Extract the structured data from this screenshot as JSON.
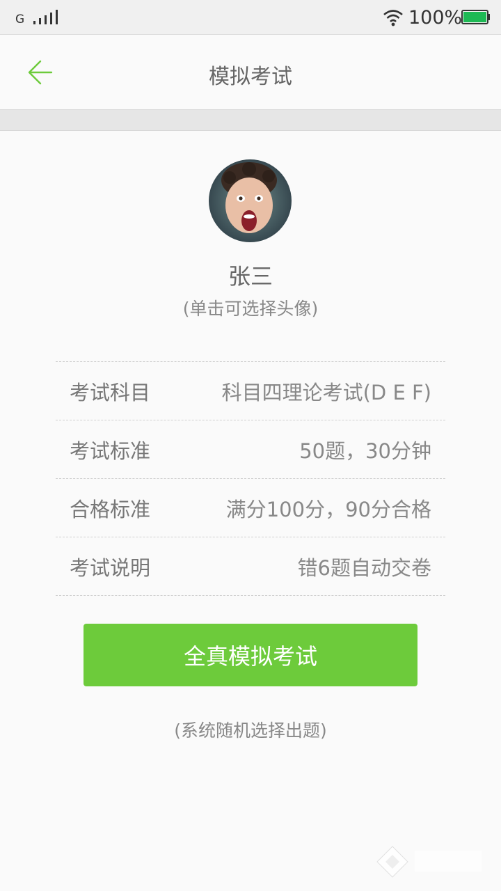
{
  "status_bar": {
    "network": "G",
    "battery_percent": "100%",
    "battery_level": 1.0,
    "battery_color": "#1db954"
  },
  "header": {
    "title": "模拟考试",
    "back_icon": "arrow-left-icon",
    "accent_color": "#6dcb3b"
  },
  "profile": {
    "name": "张三",
    "avatar_hint": "(单击可选择头像)"
  },
  "exam_info": [
    {
      "label": "考试科目",
      "value": "科目四理论考试(D E F)"
    },
    {
      "label": "考试标准",
      "value": "50题，30分钟"
    },
    {
      "label": "合格标准",
      "value": "满分100分，90分合格"
    },
    {
      "label": "考试说明",
      "value": "错6题自动交卷"
    }
  ],
  "start_button": {
    "label": "全真模拟考试",
    "color": "#6dcb3b"
  },
  "start_hint": "(系统随机选择出题)"
}
